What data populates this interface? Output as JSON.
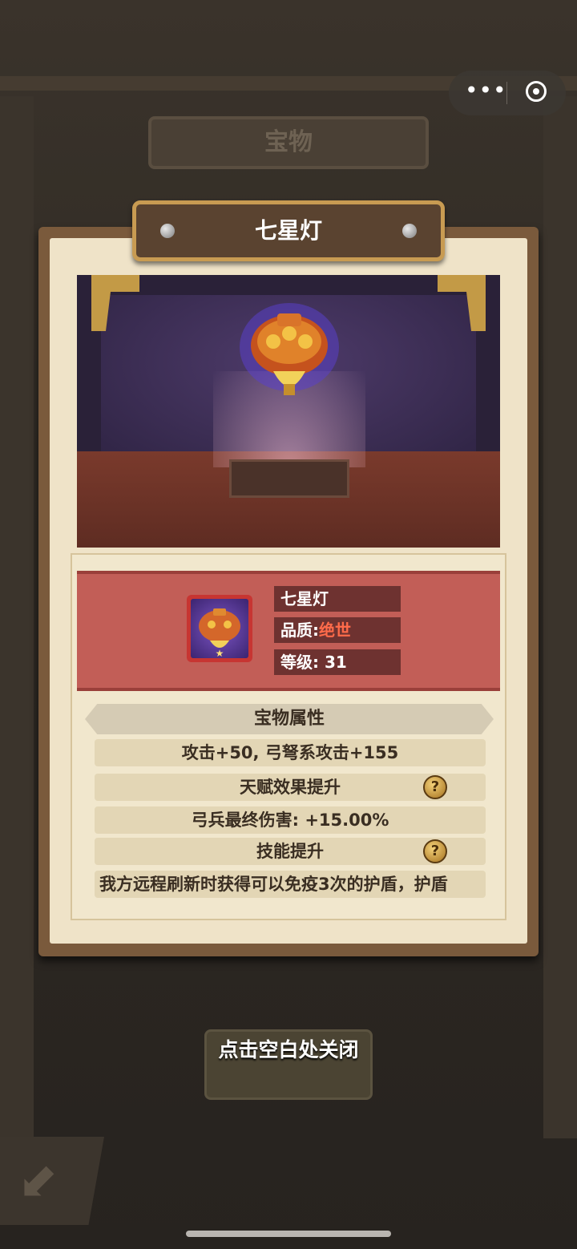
{
  "background": {
    "panel_title": "宝物"
  },
  "capsule": {
    "more_icon": "more-dots-icon",
    "close_icon": "target-circle-icon"
  },
  "dialog": {
    "title": "七星灯",
    "item": {
      "name": "七星灯",
      "quality_label": "品质:",
      "quality_value": "绝世",
      "level_label": "等级:",
      "level_value": "31"
    },
    "attributes": {
      "header": "宝物属性",
      "base_stats": "攻击+50, 弓弩系攻击+155",
      "talent_header": "天赋效果提升",
      "talent_value": "弓兵最终伤害: +15.00%",
      "skill_header": "技能提升",
      "skill_value": "我方远程刷新时获得可以免疫3次的护盾，护盾"
    }
  },
  "close_hint": "点击空白处关闭",
  "colors": {
    "banner": "#c25e57",
    "quality": "#ff6b4a",
    "title_border": "#c89b52"
  }
}
